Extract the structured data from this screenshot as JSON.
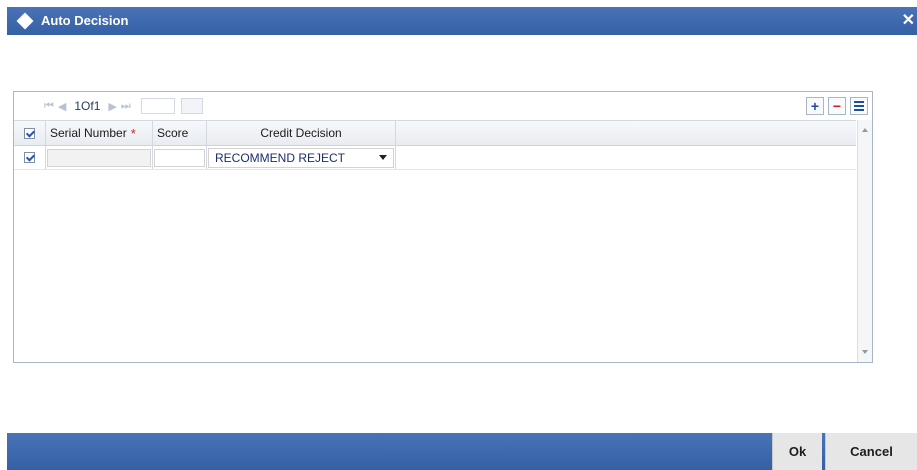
{
  "dialog": {
    "title": "Auto Decision"
  },
  "toolbar": {
    "page_info": "1Of1"
  },
  "grid": {
    "columns": {
      "serial": "Serial Number",
      "score": "Score",
      "credit": "Credit Decision"
    },
    "rows": [
      {
        "serial": "",
        "score": "",
        "credit": "RECOMMEND REJECT"
      }
    ]
  },
  "footer": {
    "ok": "Ok",
    "cancel": "Cancel"
  },
  "colors": {
    "title_bar": "#3a66ad",
    "required": "#d81c1c"
  }
}
